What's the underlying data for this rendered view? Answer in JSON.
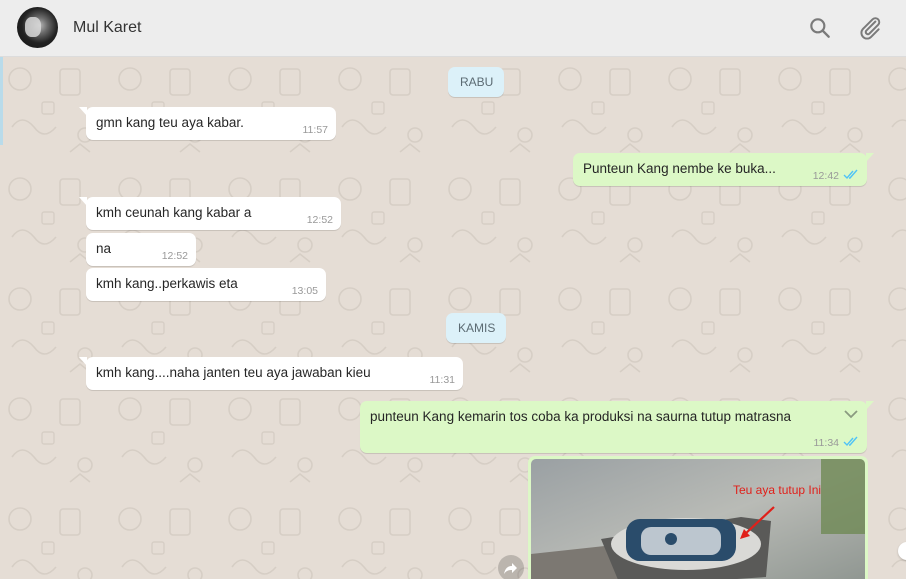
{
  "header": {
    "contact_name": "Mul Karet",
    "icons": [
      "search-icon",
      "attach-icon"
    ]
  },
  "chat": {
    "date_separators": [
      "RABU",
      "KAMIS"
    ],
    "messages": [
      {
        "direction": "in",
        "text": "gmn kang teu aya kabar.",
        "time": "11:57"
      },
      {
        "direction": "out",
        "text": "Punteun Kang nembe ke buka...",
        "time": "12:42",
        "status": "read"
      },
      {
        "direction": "in",
        "text": "kmh ceunah kang kabar a",
        "time": "12:52"
      },
      {
        "direction": "in",
        "text": "na",
        "time": "12:52"
      },
      {
        "direction": "in",
        "text": "kmh kang..perkawis eta",
        "time": "13:05"
      },
      {
        "direction": "in",
        "text": "kmh kang....naha janten teu aya jawaban kieu",
        "time": "11:31"
      },
      {
        "direction": "out",
        "text": "punteun Kang kemarin tos coba ka produksi na saurna tutup matrasna",
        "time": "11:34",
        "status": "read"
      }
    ],
    "image_message": {
      "annotation": "Teu aya tutup Ini"
    }
  },
  "colors": {
    "chat_bg": "#e5ddd5",
    "incoming_bubble": "#ffffff",
    "outgoing_bubble": "#dcf8c6",
    "date_chip": "#dcf1f9",
    "read_ticks": "#4fc3f7"
  }
}
